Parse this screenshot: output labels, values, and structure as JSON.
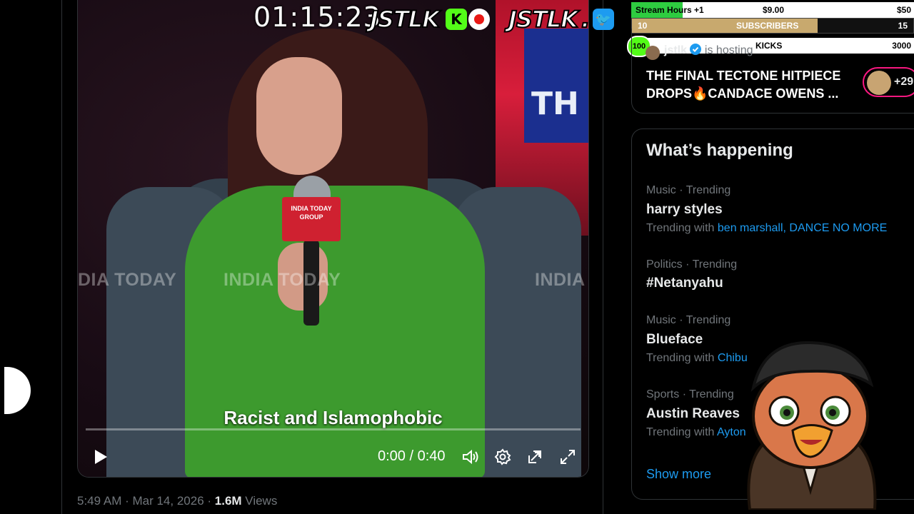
{
  "overlay": {
    "clock": "01:15:23",
    "brand_left": "JSTLK",
    "brand_right": "JSTLK",
    "brand_sep": ".",
    "kick_badge": "K",
    "twitter_badge": "🐦"
  },
  "video": {
    "watermark_left": "DIA TODAY",
    "watermark_center": "INDIA TODAY",
    "watermark_right": "INDIA",
    "mic_flag": "INDIA TODAY GROUP",
    "bg_letters": "TH",
    "caption": "Racist and Islamophobic",
    "time": "0:00 / 0:40",
    "progress": 0.0
  },
  "tweet_meta": {
    "time": "5:49 AM · Mar 14, 2026 · ",
    "views_count": "1.6M",
    "views_label": " Views"
  },
  "goals": {
    "stream_hours": {
      "label": "Stream Hours +1",
      "amount": "$9.00",
      "target": "$50"
    },
    "subscribers": {
      "current": "10",
      "label": "SUBSCRIBERS",
      "target": "15"
    },
    "kicks": {
      "current": "100",
      "label": "KICKS",
      "target": "3000"
    }
  },
  "space": {
    "host": "jstlk",
    "hosting": "is hosting",
    "title": "THE FINAL TECTONE HITPIECE DROPS🔥CANDACE OWENS ...",
    "listeners": "+29"
  },
  "whats_happening": {
    "heading": "What’s happening",
    "trends": [
      {
        "category": "Music · Trending",
        "name": "harry styles",
        "with_label": "Trending with",
        "links": [
          "ben marshall",
          "DANCE NO MORE"
        ]
      },
      {
        "category": "Politics · Trending",
        "name": "#Netanyahu"
      },
      {
        "category": "Music · Trending",
        "name": "Blueface",
        "with_label": "Trending with",
        "links": [
          "Chibu"
        ]
      },
      {
        "category": "Sports · Trending",
        "name": "Austin Reaves",
        "with_label": "Trending with",
        "links": [
          "Ayton"
        ]
      }
    ],
    "show_more": "Show more"
  },
  "colors": {
    "accent": "#1d9bf0",
    "goal_green": "#2ecc40",
    "goal_gold": "#c8a96e",
    "kick_green": "#53fc18",
    "kick_badge_bg": "#53fc18",
    "record_red": "#e91916",
    "twitter_blue": "#1d9bf0"
  },
  "icons": [
    "play-icon",
    "volume-icon",
    "settings-icon",
    "pip-icon",
    "fullscreen-icon",
    "verified-icon"
  ]
}
